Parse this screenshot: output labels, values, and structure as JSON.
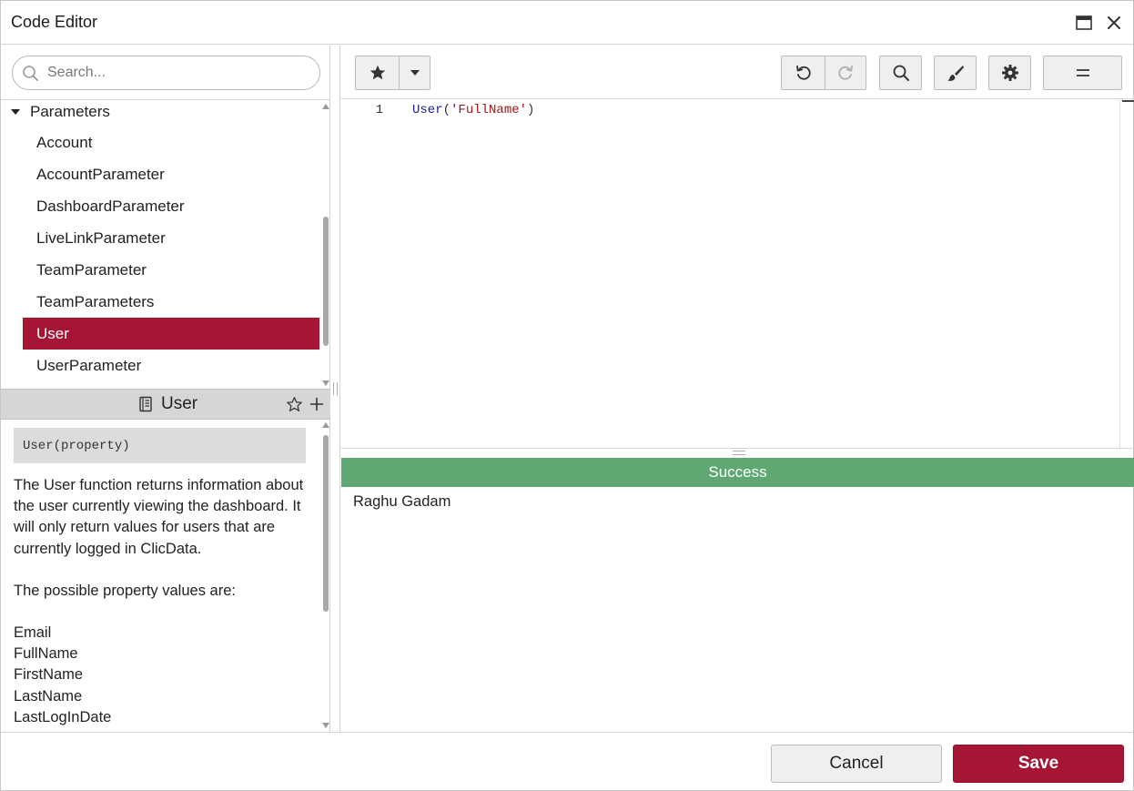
{
  "window": {
    "title": "Code Editor",
    "maximize_icon": "maximize-icon",
    "close_icon": "close-icon"
  },
  "search": {
    "placeholder": "Search...",
    "value": ""
  },
  "tree": {
    "group_label": "Parameters",
    "items": [
      {
        "label": "Account",
        "selected": false
      },
      {
        "label": "AccountParameter",
        "selected": false
      },
      {
        "label": "DashboardParameter",
        "selected": false
      },
      {
        "label": "LiveLinkParameter",
        "selected": false
      },
      {
        "label": "TeamParameter",
        "selected": false
      },
      {
        "label": "TeamParameters",
        "selected": false
      },
      {
        "label": "User",
        "selected": true
      },
      {
        "label": "UserParameter",
        "selected": false
      }
    ]
  },
  "doc": {
    "title": "User",
    "signature": "User(property)",
    "description": "The User function returns information about the user currently viewing the dashboard.  It will only return values for users that are currently logged in ClicData.",
    "values_intro": "The possible property values are:",
    "property_values": [
      "Email",
      "FullName",
      "FirstName",
      "LastName",
      "LastLogInDate"
    ]
  },
  "editor": {
    "line_number": "1",
    "code_fn": "User",
    "code_open": "(",
    "code_string": "'FullName'",
    "code_close": ")"
  },
  "output": {
    "status": "Success",
    "result": "Raghu Gadam"
  },
  "footer": {
    "cancel_label": "Cancel",
    "save_label": "Save"
  },
  "colors": {
    "accent": "#a61534",
    "success": "#5fa873"
  }
}
